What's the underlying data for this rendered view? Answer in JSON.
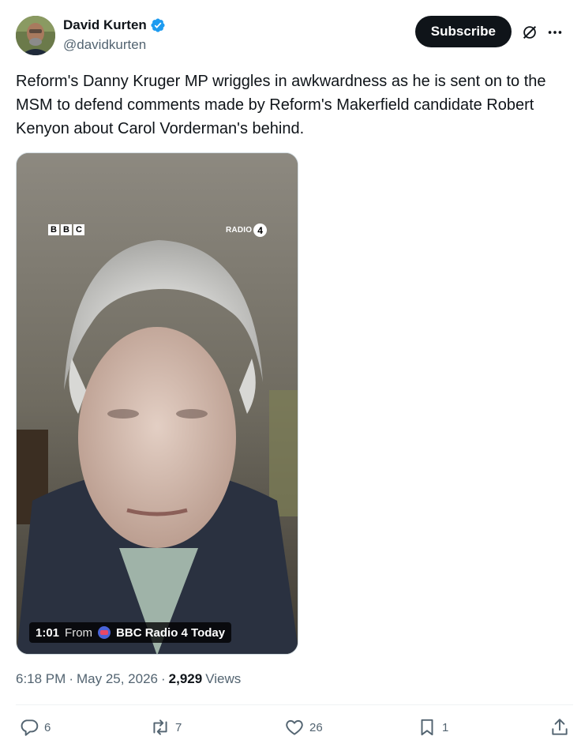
{
  "author": {
    "display_name": "David Kurten",
    "handle": "@davidkurten"
  },
  "header": {
    "subscribe_label": "Subscribe"
  },
  "tweet": {
    "text": "Reform's Danny Kruger MP wriggles in awkwardness as he is sent on to the MSM to defend comments made by Reform's Makerfield candidate Robert Kenyon about Carol Vorderman's behind."
  },
  "media": {
    "bbc_letters": [
      "B",
      "B",
      "C"
    ],
    "radio_label": "RADIO",
    "radio_number": "4",
    "duration": "1:01",
    "from_label": "From",
    "source_name": "BBC Radio 4 Today"
  },
  "meta": {
    "time": "6:18 PM",
    "date": "May 25, 2026",
    "separator": "·",
    "views_count": "2,929",
    "views_label": "Views"
  },
  "actions": {
    "replies": "6",
    "reposts": "7",
    "likes": "26",
    "bookmarks": "1"
  },
  "icons": {
    "verified": "verified-badge-icon",
    "grok": "grok-icon",
    "more": "more-icon",
    "reply": "reply-icon",
    "repost": "repost-icon",
    "like": "heart-icon",
    "bookmark": "bookmark-icon",
    "share": "share-icon"
  },
  "colors": {
    "verified_blue": "#1d9bf0",
    "text_primary": "#0f1419",
    "text_secondary": "#536471"
  }
}
